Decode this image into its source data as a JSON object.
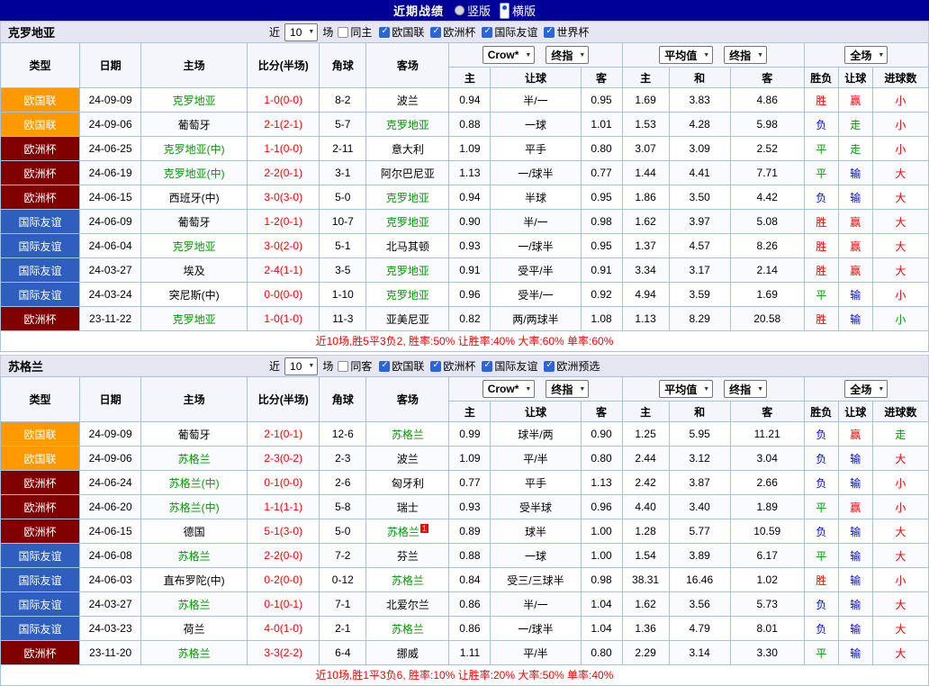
{
  "topbar": {
    "title": "近期战绩",
    "radios": [
      {
        "label": "竖版",
        "selected": false
      },
      {
        "label": "横版",
        "selected": true
      }
    ]
  },
  "colors": {
    "topbar_bg": "#000099",
    "section_bg": "#E6E6F2",
    "border": "#A4C4E4",
    "team_green": "#009900",
    "score_red": "#FF0000",
    "win_red": "#FF0000",
    "draw_green": "#009900",
    "loss_blue": "#0000FF"
  },
  "type_colors": {
    "欧国联": "#FF9900",
    "欧洲杯": "#800000",
    "国际友谊": "#2E5FBF"
  },
  "columns": {
    "type": "类型",
    "date": "日期",
    "home": "主场",
    "score": "比分(半场)",
    "corner": "角球",
    "away": "客场",
    "odds_home": "主",
    "odds_handicap": "让球",
    "odds_away": "客",
    "avg_home": "主",
    "avg_draw": "和",
    "avg_away": "客",
    "wdl": "胜负",
    "hcp_result": "让球",
    "goals": "进球数"
  },
  "sections": [
    {
      "team": "克罗地亚",
      "filters": {
        "near_label": "近",
        "near_value": "10",
        "games_label": "场",
        "same_label": "同主",
        "same_checked": false,
        "comps": [
          {
            "label": "欧国联",
            "checked": true
          },
          {
            "label": "欧洲杯",
            "checked": true
          },
          {
            "label": "国际友谊",
            "checked": true
          },
          {
            "label": "世界杯",
            "checked": true
          }
        ]
      },
      "selects": {
        "company": "Crow*",
        "company_stage": "终指",
        "average": "平均值",
        "average_stage": "终指",
        "scope": "全场"
      },
      "rows": [
        {
          "type": "欧国联",
          "date": "24-09-09",
          "home": "克罗地亚",
          "hf": true,
          "score": "1-0(0-0)",
          "corner": "8-2",
          "away": "波兰",
          "af": false,
          "o1": "0.94",
          "h": "半/一",
          "o2": "0.95",
          "m1": "1.69",
          "m2": "3.83",
          "m3": "4.86",
          "r1": "胜",
          "c1": "red",
          "r2": "赢",
          "c2": "red",
          "r3": "小",
          "c3": "red"
        },
        {
          "type": "欧国联",
          "date": "24-09-06",
          "home": "葡萄牙",
          "hf": false,
          "score": "2-1(2-1)",
          "corner": "5-7",
          "away": "克罗地亚",
          "af": true,
          "o1": "0.88",
          "h": "一球",
          "o2": "1.01",
          "m1": "1.53",
          "m2": "4.28",
          "m3": "5.98",
          "r1": "负",
          "c1": "blue",
          "r2": "走",
          "c2": "green",
          "r3": "小",
          "c3": "red"
        },
        {
          "type": "欧洲杯",
          "date": "24-06-25",
          "home": "克罗地亚(中)",
          "hf": true,
          "score": "1-1(0-0)",
          "corner": "2-11",
          "away": "意大利",
          "af": false,
          "o1": "1.09",
          "h": "平手",
          "o2": "0.80",
          "m1": "3.07",
          "m2": "3.09",
          "m3": "2.52",
          "r1": "平",
          "c1": "green",
          "r2": "走",
          "c2": "green",
          "r3": "小",
          "c3": "red"
        },
        {
          "type": "欧洲杯",
          "date": "24-06-19",
          "home": "克罗地亚(中)",
          "hf": true,
          "score": "2-2(0-1)",
          "corner": "3-1",
          "away": "阿尔巴尼亚",
          "af": false,
          "o1": "1.13",
          "h": "一/球半",
          "o2": "0.77",
          "m1": "1.44",
          "m2": "4.41",
          "m3": "7.71",
          "r1": "平",
          "c1": "green",
          "r2": "输",
          "c2": "blue",
          "r3": "大",
          "c3": "red"
        },
        {
          "type": "欧洲杯",
          "date": "24-06-15",
          "home": "西班牙(中)",
          "hf": false,
          "score": "3-0(3-0)",
          "corner": "5-0",
          "away": "克罗地亚",
          "af": true,
          "o1": "0.94",
          "h": "半球",
          "o2": "0.95",
          "m1": "1.86",
          "m2": "3.50",
          "m3": "4.42",
          "r1": "负",
          "c1": "blue",
          "r2": "输",
          "c2": "blue",
          "r3": "大",
          "c3": "red"
        },
        {
          "type": "国际友谊",
          "date": "24-06-09",
          "home": "葡萄牙",
          "hf": false,
          "score": "1-2(0-1)",
          "corner": "10-7",
          "away": "克罗地亚",
          "af": true,
          "o1": "0.90",
          "h": "半/一",
          "o2": "0.98",
          "m1": "1.62",
          "m2": "3.97",
          "m3": "5.08",
          "r1": "胜",
          "c1": "red",
          "r2": "赢",
          "c2": "red",
          "r3": "大",
          "c3": "red"
        },
        {
          "type": "国际友谊",
          "date": "24-06-04",
          "home": "克罗地亚",
          "hf": true,
          "score": "3-0(2-0)",
          "corner": "5-1",
          "away": "北马其顿",
          "af": false,
          "o1": "0.93",
          "h": "一/球半",
          "o2": "0.95",
          "m1": "1.37",
          "m2": "4.57",
          "m3": "8.26",
          "r1": "胜",
          "c1": "red",
          "r2": "赢",
          "c2": "red",
          "r3": "大",
          "c3": "red"
        },
        {
          "type": "国际友谊",
          "date": "24-03-27",
          "home": "埃及",
          "hf": false,
          "score": "2-4(1-1)",
          "corner": "3-5",
          "away": "克罗地亚",
          "af": true,
          "o1": "0.91",
          "h": "受平/半",
          "o2": "0.91",
          "m1": "3.34",
          "m2": "3.17",
          "m3": "2.14",
          "r1": "胜",
          "c1": "red",
          "r2": "赢",
          "c2": "red",
          "r3": "大",
          "c3": "red"
        },
        {
          "type": "国际友谊",
          "date": "24-03-24",
          "home": "突尼斯(中)",
          "hf": false,
          "score": "0-0(0-0)",
          "corner": "1-10",
          "away": "克罗地亚",
          "af": true,
          "o1": "0.96",
          "h": "受半/一",
          "o2": "0.92",
          "m1": "4.94",
          "m2": "3.59",
          "m3": "1.69",
          "r1": "平",
          "c1": "green",
          "r2": "输",
          "c2": "blue",
          "r3": "小",
          "c3": "red"
        },
        {
          "type": "欧洲杯",
          "date": "23-11-22",
          "home": "克罗地亚",
          "hf": true,
          "score": "1-0(1-0)",
          "corner": "11-3",
          "away": "亚美尼亚",
          "af": false,
          "o1": "0.82",
          "h": "两/两球半",
          "o2": "1.08",
          "m1": "1.13",
          "m2": "8.29",
          "m3": "20.58",
          "r1": "胜",
          "c1": "red",
          "r2": "输",
          "c2": "blue",
          "r3": "小",
          "c3": "green"
        }
      ],
      "summary": "近10场,胜5平3负2, 胜率:50% 让胜率:40% 大率:60% 单率:60%"
    },
    {
      "team": "苏格兰",
      "filters": {
        "near_label": "近",
        "near_value": "10",
        "games_label": "场",
        "same_label": "同客",
        "same_checked": false,
        "comps": [
          {
            "label": "欧国联",
            "checked": true
          },
          {
            "label": "欧洲杯",
            "checked": true
          },
          {
            "label": "国际友谊",
            "checked": true
          },
          {
            "label": "欧洲预选",
            "checked": true
          }
        ]
      },
      "selects": {
        "company": "Crow*",
        "company_stage": "终指",
        "average": "平均值",
        "average_stage": "终指",
        "scope": "全场"
      },
      "rows": [
        {
          "type": "欧国联",
          "date": "24-09-09",
          "home": "葡萄牙",
          "hf": false,
          "score": "2-1(0-1)",
          "corner": "12-6",
          "away": "苏格兰",
          "af": true,
          "o1": "0.99",
          "h": "球半/两",
          "o2": "0.90",
          "m1": "1.25",
          "m2": "5.95",
          "m3": "11.21",
          "r1": "负",
          "c1": "blue",
          "r2": "赢",
          "c2": "red",
          "r3": "走",
          "c3": "green"
        },
        {
          "type": "欧国联",
          "date": "24-09-06",
          "home": "苏格兰",
          "hf": true,
          "score": "2-3(0-2)",
          "corner": "2-3",
          "away": "波兰",
          "af": false,
          "o1": "1.09",
          "h": "平/半",
          "o2": "0.80",
          "m1": "2.44",
          "m2": "3.12",
          "m3": "3.04",
          "r1": "负",
          "c1": "blue",
          "r2": "输",
          "c2": "blue",
          "r3": "大",
          "c3": "red"
        },
        {
          "type": "欧洲杯",
          "date": "24-06-24",
          "home": "苏格兰(中)",
          "hf": true,
          "score": "0-1(0-0)",
          "corner": "2-6",
          "away": "匈牙利",
          "af": false,
          "o1": "0.77",
          "h": "平手",
          "o2": "1.13",
          "m1": "2.42",
          "m2": "3.87",
          "m3": "2.66",
          "r1": "负",
          "c1": "blue",
          "r2": "输",
          "c2": "blue",
          "r3": "小",
          "c3": "red"
        },
        {
          "type": "欧洲杯",
          "date": "24-06-20",
          "home": "苏格兰(中)",
          "hf": true,
          "score": "1-1(1-1)",
          "corner": "5-8",
          "away": "瑞士",
          "af": false,
          "o1": "0.93",
          "h": "受半球",
          "o2": "0.96",
          "m1": "4.40",
          "m2": "3.40",
          "m3": "1.89",
          "r1": "平",
          "c1": "green",
          "r2": "赢",
          "c2": "red",
          "r3": "小",
          "c3": "red"
        },
        {
          "type": "欧洲杯",
          "date": "24-06-15",
          "home": "德国",
          "hf": false,
          "score": "5-1(3-0)",
          "corner": "5-0",
          "away": "苏格兰",
          "af": true,
          "sup": "1",
          "o1": "0.89",
          "h": "球半",
          "o2": "1.00",
          "m1": "1.28",
          "m2": "5.77",
          "m3": "10.59",
          "r1": "负",
          "c1": "blue",
          "r2": "输",
          "c2": "blue",
          "r3": "大",
          "c3": "red"
        },
        {
          "type": "国际友谊",
          "date": "24-06-08",
          "home": "苏格兰",
          "hf": true,
          "score": "2-2(0-0)",
          "corner": "7-2",
          "away": "芬兰",
          "af": false,
          "o1": "0.88",
          "h": "一球",
          "o2": "1.00",
          "m1": "1.54",
          "m2": "3.89",
          "m3": "6.17",
          "r1": "平",
          "c1": "green",
          "r2": "输",
          "c2": "blue",
          "r3": "大",
          "c3": "red"
        },
        {
          "type": "国际友谊",
          "date": "24-06-03",
          "home": "直布罗陀(中)",
          "hf": false,
          "score": "0-2(0-0)",
          "corner": "0-12",
          "away": "苏格兰",
          "af": true,
          "o1": "0.84",
          "h": "受三/三球半",
          "o2": "0.98",
          "m1": "38.31",
          "m2": "16.46",
          "m3": "1.02",
          "r1": "胜",
          "c1": "red",
          "r2": "输",
          "c2": "blue",
          "r3": "小",
          "c3": "red"
        },
        {
          "type": "国际友谊",
          "date": "24-03-27",
          "home": "苏格兰",
          "hf": true,
          "score": "0-1(0-1)",
          "corner": "7-1",
          "away": "北爱尔兰",
          "af": false,
          "o1": "0.86",
          "h": "半/一",
          "o2": "1.04",
          "m1": "1.62",
          "m2": "3.56",
          "m3": "5.73",
          "r1": "负",
          "c1": "blue",
          "r2": "输",
          "c2": "blue",
          "r3": "大",
          "c3": "red"
        },
        {
          "type": "国际友谊",
          "date": "24-03-23",
          "home": "荷兰",
          "hf": false,
          "score": "4-0(1-0)",
          "corner": "2-1",
          "away": "苏格兰",
          "af": true,
          "o1": "0.86",
          "h": "一/球半",
          "o2": "1.04",
          "m1": "1.36",
          "m2": "4.79",
          "m3": "8.01",
          "r1": "负",
          "c1": "blue",
          "r2": "输",
          "c2": "blue",
          "r3": "大",
          "c3": "red"
        },
        {
          "type": "欧洲杯",
          "date": "23-11-20",
          "home": "苏格兰",
          "hf": true,
          "score": "3-3(2-2)",
          "corner": "6-4",
          "away": "挪威",
          "af": false,
          "o1": "1.11",
          "h": "平/半",
          "o2": "0.80",
          "m1": "2.29",
          "m2": "3.14",
          "m3": "3.30",
          "r1": "平",
          "c1": "green",
          "r2": "输",
          "c2": "blue",
          "r3": "大",
          "c3": "red"
        }
      ],
      "summary": "近10场,胜1平3负6, 胜率:10% 让胜率:20% 大率:50% 单率:40%"
    }
  ]
}
